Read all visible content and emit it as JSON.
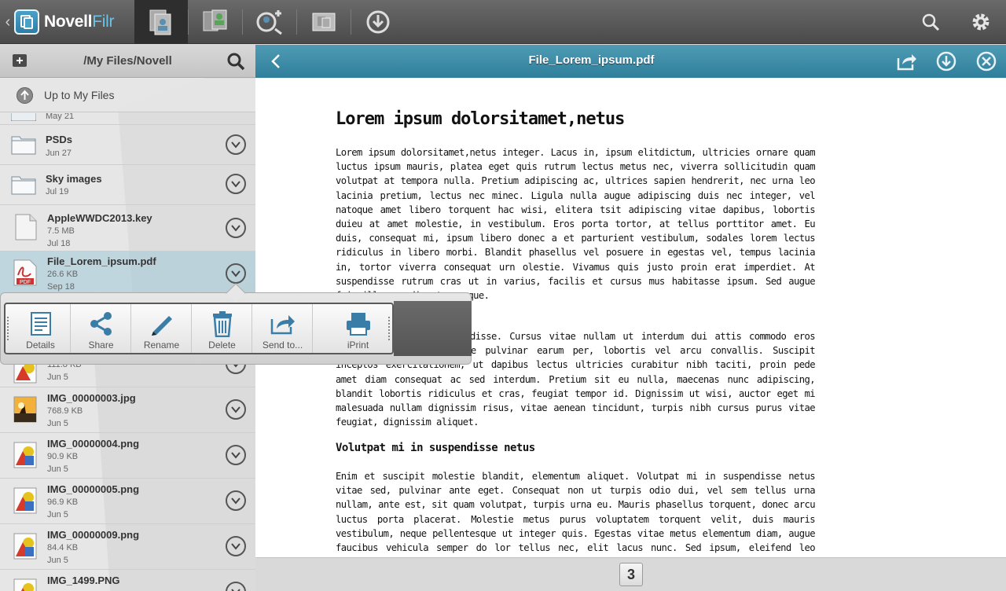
{
  "app": {
    "brand_name": "Novell",
    "brand_suffix": "Filr"
  },
  "left": {
    "path": "/My Files/Novell",
    "up_label": "Up to My Files",
    "files": [
      {
        "name": "",
        "size": "",
        "date": "May 21",
        "icon": "folder-icon"
      },
      {
        "name": "PSDs",
        "size": "",
        "date": "Jun 27",
        "icon": "folder-icon"
      },
      {
        "name": "Sky images",
        "size": "",
        "date": "Jul 19",
        "icon": "folder-icon"
      },
      {
        "name": "AppleWWDC2013.key",
        "size": "7.5 MB",
        "date": "Jul 18",
        "icon": "document-icon"
      },
      {
        "name": "File_Lorem_ipsum.pdf",
        "size": "26.6 KB",
        "date": "Sep 18",
        "icon": "pdf-icon"
      },
      {
        "name": "",
        "size": "111.8 KB",
        "date": "Jun 5",
        "icon": "image-icon"
      },
      {
        "name": "IMG_00000003.jpg",
        "size": "768.9 KB",
        "date": "Jun 5",
        "icon": "photo-icon"
      },
      {
        "name": "IMG_00000004.png",
        "size": "90.9 KB",
        "date": "Jun 5",
        "icon": "image-icon"
      },
      {
        "name": "IMG_00000005.png",
        "size": "96.9 KB",
        "date": "Jun 5",
        "icon": "image-icon"
      },
      {
        "name": "IMG_00000009.png",
        "size": "84.4 KB",
        "date": "Jun 5",
        "icon": "image-icon"
      },
      {
        "name": "IMG_1499.PNG",
        "size": "",
        "date": "",
        "icon": "image-icon"
      }
    ]
  },
  "actions": [
    {
      "label": "Details",
      "icon": "details-icon"
    },
    {
      "label": "Share",
      "icon": "share-icon"
    },
    {
      "label": "Rename",
      "icon": "pencil-icon"
    },
    {
      "label": "Delete",
      "icon": "trash-icon"
    },
    {
      "label": "Send to...",
      "icon": "send-to-icon"
    },
    {
      "label": "iPrint",
      "icon": "printer-icon"
    }
  ],
  "viewer": {
    "title": "File_Lorem_ipsum.pdf",
    "heading": "Lorem ipsum dolorsitamet,netus",
    "para1": "Lorem ipsum dolorsitamet,netus integer. Lacus in, ipsum elitdictum, ultricies ornare quam luctus ipsum mauris, platea eget quis rutrum lectus metus nec, viverra sollicitudin quam volutpat at tempora nulla. Pretium adipiscing ac, ultrices sapien hendrerit, nec urna leo lacinia pretium, lectus nec minec. Ligula nulla augue adipiscing duis nec integer, vel natoque amet libero torquent hac wisi, elitera tsit adipiscing vitae dapibus, lobortis duieu at amet molestie, in vestibulum. Eros porta tortor, at tellus porttitor amet. Eu duis, consequat mi, ipsum libero donec a et parturient vestibulum, sodales lorem lectus ridiculus in libero morbi. Blandit phasellus vel posuere in egestas vel, tempus lacinia in, tortor viverra consequat urn olestie. Vivamus quis justo proin erat imperdiet. At suspendisse rutrum cras ut in varius, facilis et cursus mus habitasse ipsum. Sed augue fringilla, condimentum neque.",
    "para2": "etus, pulvinar ut suspendisse. Cursus vitae nullam ut interdum dui attis commodo eros adipiscing commodo, vitae pulvinar earum per, lobortis vel arcu convallis. Suscipit inceptos exercitationem, ut dapibus lectus ultricies curabitur nibh taciti, proin pede amet diam consequat ac sed interdum. Pretium sit eu nulla, maecenas nunc adipiscing, blandit lobortis ridiculus et cras, feugiat tempor id. Dignissim ut wisi, auctor eget mi malesuada nullam dignissim risus, vitae aenean tincidunt, turpis nibh cursus purus vitae feugiat, dignissim aliquet.",
    "heading2": "Volutpat mi in suspendisse netus",
    "para3": "Enim et suscipit molestie blandit, elementum aliquet. Volutpat mi in suspendisse netus vitae sed, pulvinar ante eget. Consequat non ut turpis odio dui, vel sem tellus urna nullam, ante est, sit quam volutpat, turpis urna eu. Mauris phasellus torquent, donec arcu luctus porta placerat. Molestie metus purus voluptatem torquent velit, duis mauris vestibulum, neque pellentesque ut integer quis. Egestas vitae metus elementum diam, augue faucibus vehicula semper do lor tellus nec, elit lacus nunc. Sed ipsum, eleifend leo aliquam placerat lorem varius, habitant cras magna",
    "page": "3"
  }
}
